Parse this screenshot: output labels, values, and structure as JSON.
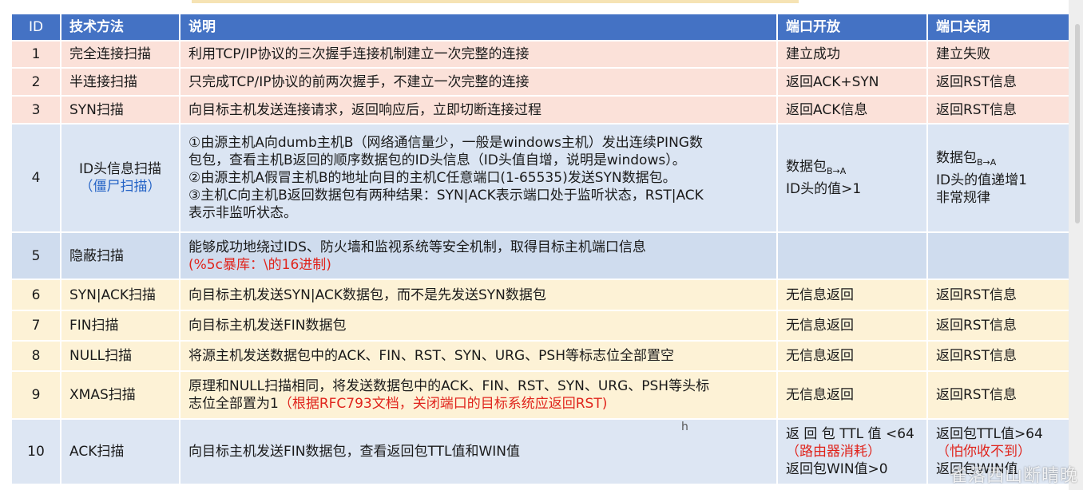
{
  "headers": {
    "id": "ID",
    "method": "技术方法",
    "desc": "说明",
    "open": "端口开放",
    "closed": "端口关闭"
  },
  "rows": [
    {
      "id": "1",
      "method": "完全连接扫描",
      "desc": "利用TCP/IP协议的三次握手连接机制建立一次完整的连接",
      "open": "建立成功",
      "closed": "建立失败"
    },
    {
      "id": "2",
      "method": "半连接扫描",
      "desc": "只完成TCP/IP协议的前两次握手，不建立一次完整的连接",
      "open": "返回ACK+SYN",
      "closed": "返回RST信息"
    },
    {
      "id": "3",
      "method": "SYN扫描",
      "desc": "向目标主机发送连接请求，返回响应后，立即切断连接过程",
      "open": "返回ACK信息",
      "closed": "返回RST信息"
    },
    {
      "id": "4",
      "method": "ID头信息扫描",
      "method_note": "（僵尸扫描）",
      "desc_lines": [
        "①由源主机A向dumb主机B（网络通信量少，一般是windows主机）发出连续PING数",
        "包包，查看主机B返回的顺序数据包的ID头信息（ID头值自增，说明是windows）。",
        "②由源主机A假冒主机B的地址向目的主机C任意端口(1-65535)发送SYN数据包。",
        "③主机C向主机B返回数据包有两种结果：SYN|ACK表示端口处于监听状态，RST|ACK",
        "表示非监听状态。"
      ],
      "open_main": "数据包",
      "open_sub": "B→A",
      "open_line2": "ID头的值>1",
      "closed_main": "数据包",
      "closed_sub": "B→A",
      "closed_line2": "ID头的值递增1",
      "closed_line3": "非常规律"
    },
    {
      "id": "5",
      "method": "隐蔽扫描",
      "desc": "能够成功地绕过IDS、防火墙和监视系统等安全机制，取得目标主机端口信息",
      "desc_note": "(%5c暴库：\\的16进制)",
      "open": "",
      "closed": ""
    },
    {
      "id": "6",
      "method": "SYN|ACK扫描",
      "desc": "向目标主机发送SYN|ACK数据包，而不是先发送SYN数据包",
      "open": "无信息返回",
      "closed": "返回RST信息"
    },
    {
      "id": "7",
      "method": "FIN扫描",
      "desc": "向目标主机发送FIN数据包",
      "open": "无信息返回",
      "closed": "返回RST信息"
    },
    {
      "id": "8",
      "method": "NULL扫描",
      "desc": "将源主机发送数据包中的ACK、FIN、RST、SYN、URG、PSH等标志位全部置空",
      "open": "无信息返回",
      "closed": "返回RST信息"
    },
    {
      "id": "9",
      "method": "XMAS扫描",
      "desc": "原理和NULL扫描相同，将发送数据包中的ACK、FIN、RST、SYN、URG、PSH等头标",
      "desc_line2": "志位全部置为1",
      "desc_note": "（根据RFC793文档，关闭端口的目标系统应返回RST)",
      "open": "无信息返回",
      "closed": "返回RST信息"
    },
    {
      "id": "10",
      "method": "ACK扫描",
      "desc": "向目标主机发送FIN数据包，查看返回包TTL值和WIN值",
      "open_line1": "返 回 包 TTL 值 <64",
      "open_note": "（路由器消耗）",
      "open_line3": "返回包WIN值>0",
      "closed_line1": "返回包TTL值>64",
      "closed_note": "（怕你收不到）",
      "closed_line3": "返回包WIN值"
    }
  ],
  "watermark": "雀落西山断晴晚",
  "cursor_glyph": "h"
}
